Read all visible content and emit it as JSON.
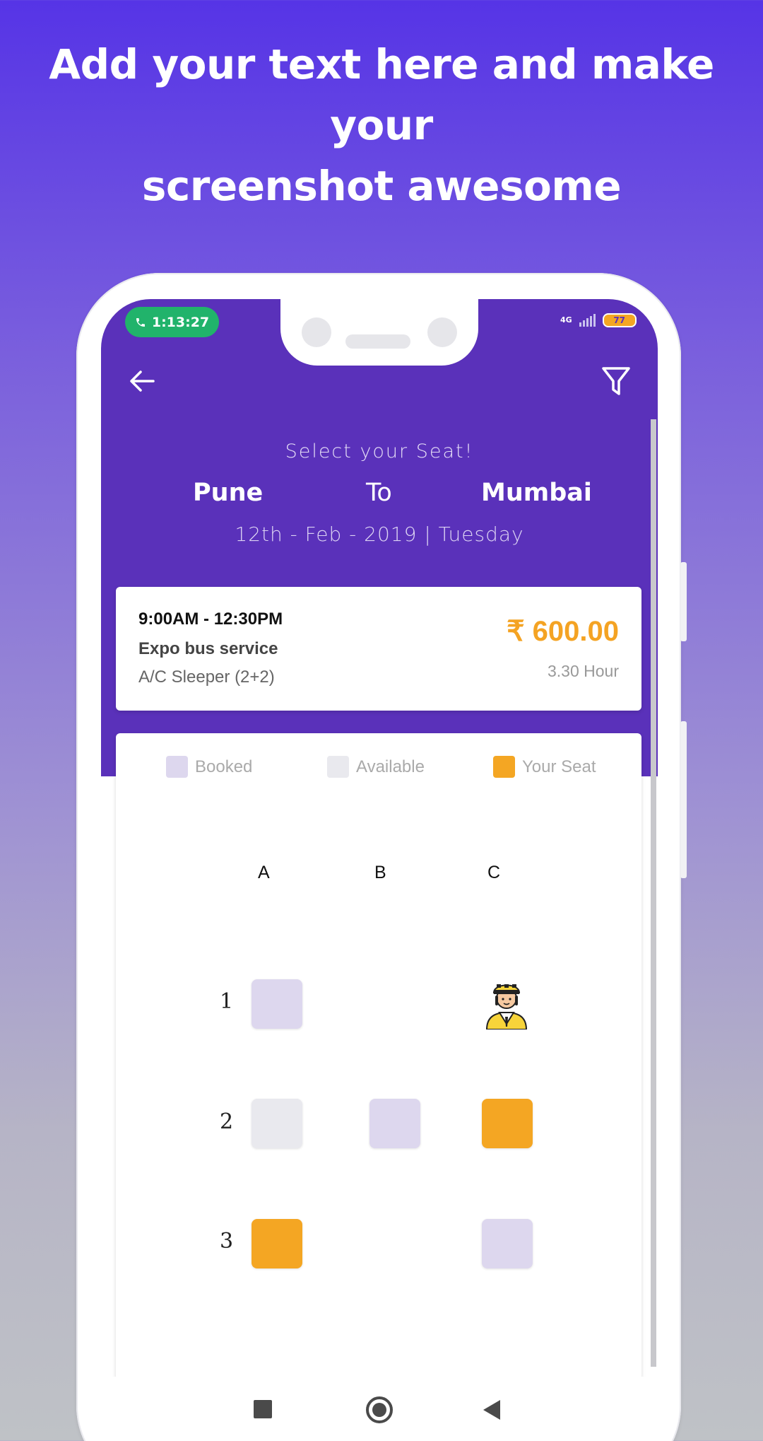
{
  "headline": {
    "line1": "Add your text here and make your",
    "line2": "screenshot awesome"
  },
  "status_bar": {
    "call_timer": "1:13:27",
    "network": "4G",
    "battery": "77"
  },
  "header": {
    "title": "Select your Seat!",
    "from": "Pune",
    "separator": "To",
    "to": "Mumbai",
    "date": "12th - Feb - 2019 | Tuesday"
  },
  "trip": {
    "time": "9:00AM - 12:30PM",
    "operator": "Expo bus service",
    "bus_type": "A/C Sleeper (2+2)",
    "fare": "₹ 600.00",
    "duration": "3.30 Hour"
  },
  "legend": {
    "booked": "Booked",
    "available": "Available",
    "your_seat": "Your Seat"
  },
  "colors": {
    "booked": "#ddd7ee",
    "available": "#e9e9ee",
    "your_seat": "#f4a623",
    "header": "#5a31ba"
  },
  "seat_map": {
    "columns": [
      "A",
      "B",
      "C"
    ],
    "rows": [
      "1",
      "2",
      "3"
    ],
    "driver_icon": "driver-icon",
    "seats": {
      "1A": "booked",
      "1C": "driver",
      "2A": "available",
      "2B": "booked",
      "2C": "your_seat",
      "3A": "your_seat",
      "3C": "booked"
    }
  }
}
